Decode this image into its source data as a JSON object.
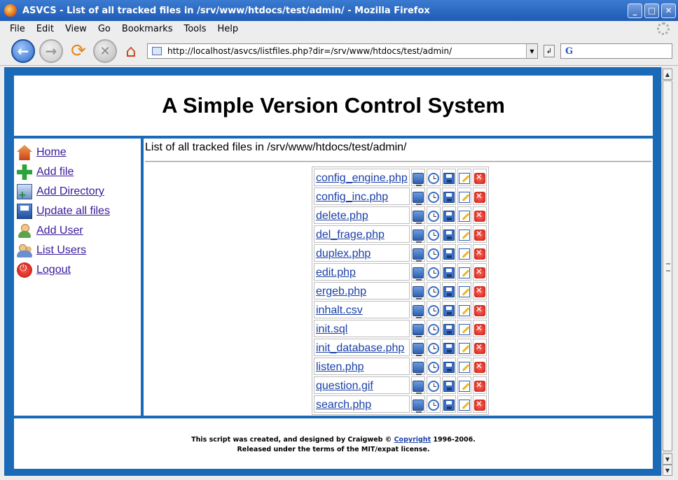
{
  "window": {
    "title": "ASVCS - List of all tracked files in /srv/www/htdocs/test/admin/ - Mozilla Firefox",
    "controls": [
      "_",
      "□",
      "✕"
    ]
  },
  "menu": [
    "File",
    "Edit",
    "View",
    "Go",
    "Bookmarks",
    "Tools",
    "Help"
  ],
  "toolbar": {
    "url": "http://localhost/asvcs/listfiles.php?dir=/srv/www/htdocs/test/admin/",
    "search_engine_glyph": "G"
  },
  "page": {
    "title": "A Simple Version Control System",
    "heading": "List of all tracked files in /srv/www/htdocs/test/admin/",
    "sidebar": [
      {
        "label": "Home",
        "icon": "home-icon"
      },
      {
        "label": "Add file",
        "icon": "add-file-icon"
      },
      {
        "label": "Add Directory",
        "icon": "add-directory-icon"
      },
      {
        "label": "Update all files",
        "icon": "update-icon"
      },
      {
        "label": "Add User",
        "icon": "add-user-icon"
      },
      {
        "label": "List Users",
        "icon": "users-icon"
      },
      {
        "label": "Logout",
        "icon": "logout-icon"
      }
    ],
    "files": [
      "config_engine.php",
      "config_inc.php",
      "delete.php",
      "del_frage.php",
      "duplex.php",
      "edit.php",
      "ergeb.php",
      "inhalt.csv",
      "init.sql",
      "init_database.php",
      "listen.php",
      "question.gif",
      "search.php"
    ],
    "file_actions": [
      "view-icon",
      "history-icon",
      "save-icon",
      "edit-icon",
      "delete-icon"
    ],
    "footer": {
      "line1_before": "This script was created, and designed by Craigweb © ",
      "copyright_link": "Copyright",
      "line1_after": " 1996-2006.",
      "line2": "Released under the terms of the MIT/expat license."
    }
  }
}
